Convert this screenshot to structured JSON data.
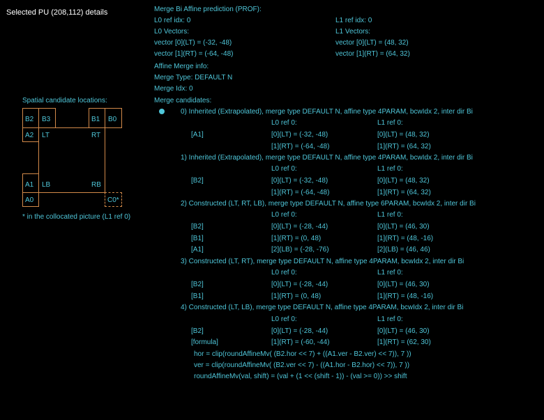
{
  "title": "Selected PU (208,112) details",
  "header": "Merge Bi Affine prediction (PROF):",
  "l0": {
    "ref": "L0 ref idx: 0",
    "vec_label": "L0 Vectors:",
    "v0": "vector [0](LT) = (-32, -48)",
    "v1": "vector [1](RT) = (-64, -48)"
  },
  "l1": {
    "ref": "L1 ref idx: 0",
    "vec_label": "L1 Vectors:",
    "v0": "vector [0](LT) = (48, 32)",
    "v1": "vector [1](RT) = (64, 32)"
  },
  "affine_info": "Affine Merge info:",
  "merge_type": "Merge Type: DEFAULT N",
  "merge_idx": "Merge Idx: 0",
  "merge_candidates": "Merge candidates:",
  "spatial": {
    "title": "Spatial candidate locations:",
    "B2": "B2",
    "B3": "B3",
    "B1": "B1",
    "B0": "B0",
    "A2": "A2",
    "LT": "LT",
    "RT": "RT",
    "A1": "A1",
    "LB": "LB",
    "RB": "RB",
    "A0": "A0",
    "C0": "C0*",
    "note": "* in the collocated picture (L1 ref 0)"
  },
  "candidates": [
    {
      "header": "0) Inherited (Extrapolated),  merge type DEFAULT N, affine type 4PARAM, bcwIdx 2, inter dir Bi",
      "l0_ref": "L0 ref 0:",
      "l1_ref": "L1 ref 0:",
      "rows": [
        {
          "label": "[A1]",
          "l0": "[0](LT) = (-32, -48)",
          "l1": "[0](LT) = (48, 32)"
        },
        {
          "label": "",
          "l0": "[1](RT) = (-64, -48)",
          "l1": "[1](RT) = (64, 32)"
        }
      ]
    },
    {
      "header": "1) Inherited (Extrapolated),  merge type DEFAULT N, affine type 4PARAM, bcwIdx 2, inter dir Bi",
      "l0_ref": "L0 ref 0:",
      "l1_ref": "L1 ref 0:",
      "rows": [
        {
          "label": "[B2]",
          "l0": "[0](LT) = (-32, -48)",
          "l1": "[0](LT) = (48, 32)"
        },
        {
          "label": "",
          "l0": "[1](RT) = (-64, -48)",
          "l1": "[1](RT) = (64, 32)"
        }
      ]
    },
    {
      "header": "2) Constructed (LT, RT, LB),  merge type DEFAULT N, affine type 6PARAM, bcwIdx 2, inter dir Bi",
      "l0_ref": "L0 ref 0:",
      "l1_ref": "L1 ref 0:",
      "rows": [
        {
          "label": "[B2]",
          "l0": "[0](LT) = (-28, -44)",
          "l1": "[0](LT) = (46, 30)"
        },
        {
          "label": "[B1]",
          "l0": "[1](RT) = (0, 48)",
          "l1": "[1](RT) = (48, -16)"
        },
        {
          "label": "[A1]",
          "l0": "[2](LB) = (-28, -76)",
          "l1": "[2](LB) = (46, 46)"
        }
      ]
    },
    {
      "header": "3) Constructed (LT, RT),  merge type DEFAULT N, affine type 4PARAM, bcwIdx 2, inter dir Bi",
      "l0_ref": "L0 ref 0:",
      "l1_ref": "L1 ref 0:",
      "rows": [
        {
          "label": "[B2]",
          "l0": "[0](LT) = (-28, -44)",
          "l1": "[0](LT) = (46, 30)"
        },
        {
          "label": "[B1]",
          "l0": "[1](RT) = (0, 48)",
          "l1": "[1](RT) = (48, -16)"
        }
      ]
    },
    {
      "header": "4) Constructed (LT, LB),  merge type DEFAULT N, affine type 4PARAM, bcwIdx 2, inter dir Bi",
      "l0_ref": "L0 ref 0:",
      "l1_ref": "L1 ref 0:",
      "rows": [
        {
          "label": "[B2]",
          "l0": "[0](LT) = (-28, -44)",
          "l1": "[0](LT) = (46, 30)"
        },
        {
          "label": "[formula]",
          "l0": "[1](RT) = (-60, -44)",
          "l1": "[1](RT) = (62, 30)"
        }
      ]
    }
  ],
  "formulas": [
    "hor = clip(roundAffineMv( (B2.hor << 7) + ((A1.ver - B2.ver) << 7)), 7 ))",
    "ver = clip(roundAffineMv( (B2.ver << 7) - ((A1.hor - B2.hor) << 7)), 7 ))",
    "roundAffineMv(val, shift) = (val + (1 << (shift - 1)) - (val >= 0)) >> shift"
  ],
  "colors": {
    "background": "#000000",
    "text": "#4fc6d9",
    "title": "#ffffff",
    "diagram": "#d38a4a"
  }
}
